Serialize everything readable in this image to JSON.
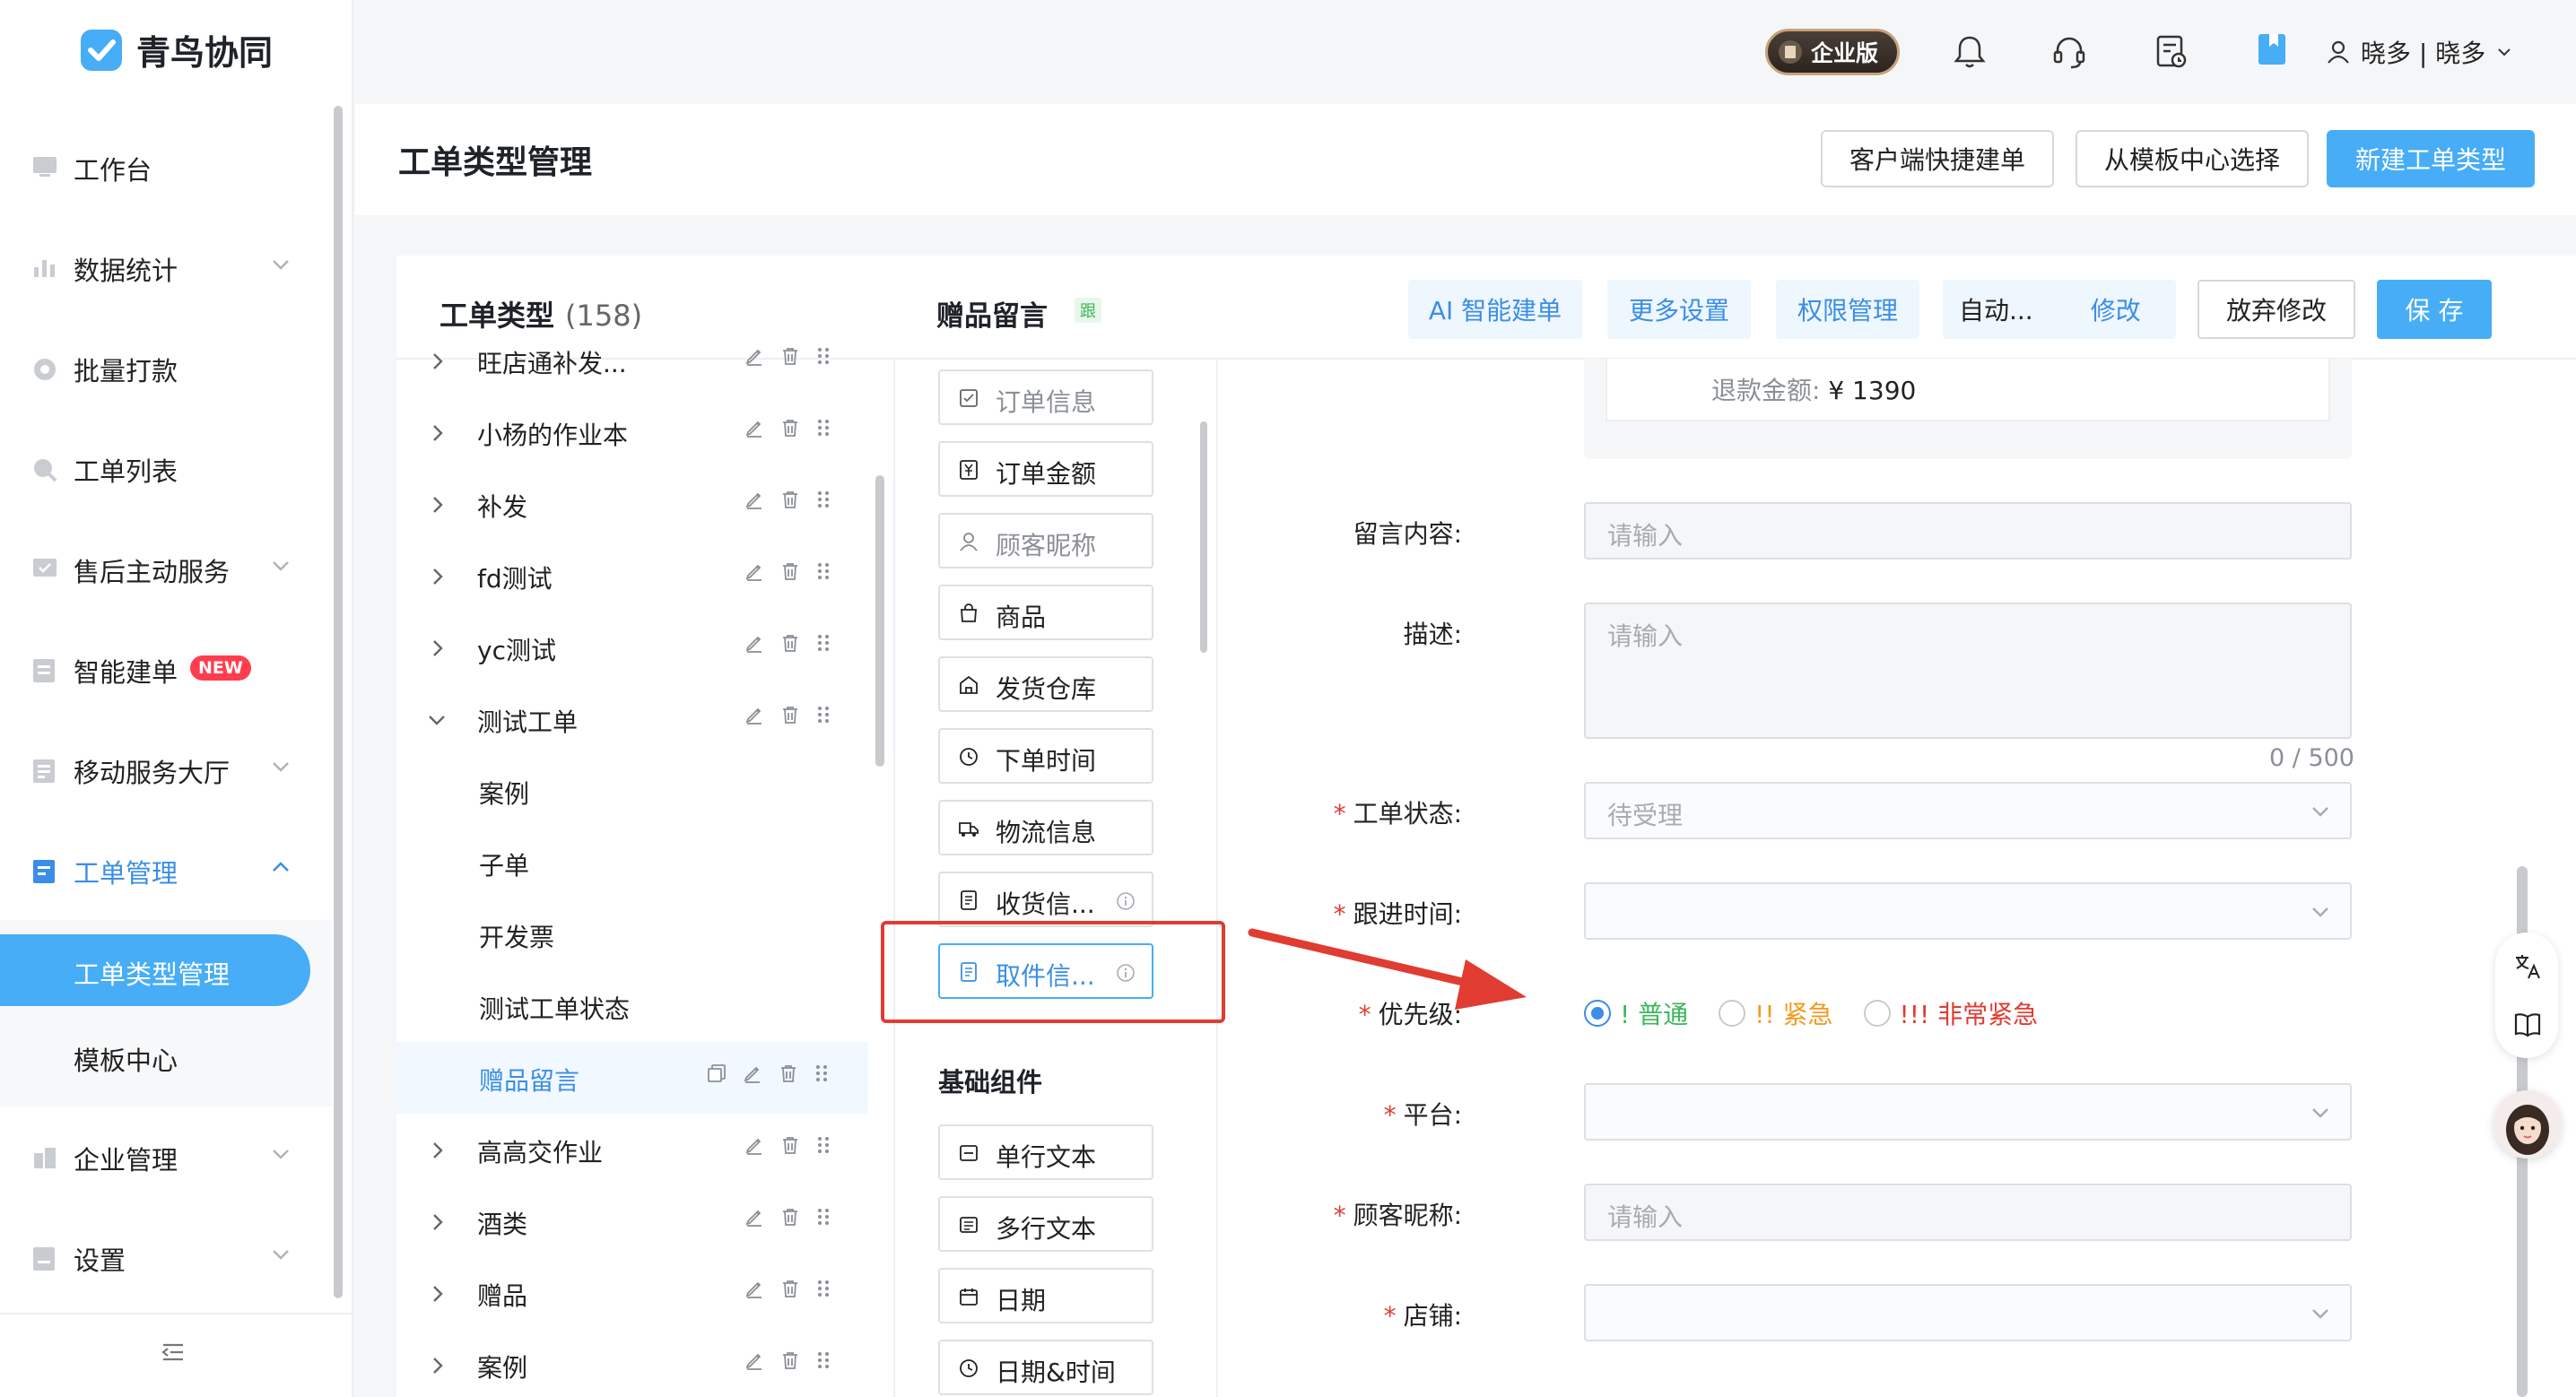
{
  "app": {
    "name": "青鸟协同"
  },
  "header": {
    "edition": "企业版",
    "user": "晓多 | 晓多"
  },
  "sidebar": {
    "items": [
      {
        "label": "工作台"
      },
      {
        "label": "数据统计"
      },
      {
        "label": "批量打款"
      },
      {
        "label": "工单列表"
      },
      {
        "label": "售后主动服务"
      },
      {
        "label": "智能建单",
        "badge": "NEW"
      },
      {
        "label": "移动服务大厅"
      },
      {
        "label": "工单管理"
      },
      {
        "label": "企业管理"
      },
      {
        "label": "设置"
      }
    ],
    "subitems": [
      {
        "label": "工单类型管理"
      },
      {
        "label": "模板中心"
      }
    ]
  },
  "page": {
    "title": "工单类型管理",
    "buttons": {
      "quick": "客户端快捷建单",
      "template": "从模板中心选择",
      "new": "新建工单类型"
    }
  },
  "types_panel": {
    "title": "工单类型",
    "count": "(158)",
    "rows": [
      {
        "label": "旺店通补发..."
      },
      {
        "label": "小杨的作业本"
      },
      {
        "label": "补发"
      },
      {
        "label": "fd测试"
      },
      {
        "label": "yc测试"
      },
      {
        "label": "测试工单"
      },
      {
        "label": "案例"
      },
      {
        "label": "子单"
      },
      {
        "label": "开发票"
      },
      {
        "label": "测试工单状态"
      },
      {
        "label": "赠品留言"
      },
      {
        "label": "高高交作业"
      },
      {
        "label": "酒类"
      },
      {
        "label": "赠品"
      },
      {
        "label": "案例"
      }
    ]
  },
  "editor": {
    "title": "赠品留言",
    "tag": "跟",
    "toolbar": {
      "ai": "AI 智能建单",
      "more": "更多设置",
      "perm": "权限管理",
      "auto": "自动...",
      "edit": "修改",
      "discard": "放弃修改",
      "save": "保 存"
    }
  },
  "palette": {
    "items": [
      {
        "label": "订单信息"
      },
      {
        "label": "订单金额"
      },
      {
        "label": "顾客昵称"
      },
      {
        "label": "商品"
      },
      {
        "label": "发货仓库"
      },
      {
        "label": "下单时间"
      },
      {
        "label": "物流信息"
      },
      {
        "label": "收货信..."
      },
      {
        "label": "取件信..."
      }
    ],
    "section": "基础组件",
    "basic": [
      {
        "label": "单行文本"
      },
      {
        "label": "多行文本"
      },
      {
        "label": "日期"
      },
      {
        "label": "日期&时间"
      }
    ]
  },
  "form": {
    "refund_label": "退款金额:",
    "refund_value": "¥ 1390",
    "fields": {
      "message": {
        "label": "留言内容:",
        "placeholder": "请输入"
      },
      "desc": {
        "label": "描述:",
        "placeholder": "请输入",
        "counter": "0 / 500"
      },
      "status": {
        "label": "工单状态:",
        "value": "待受理"
      },
      "followup": {
        "label": "跟进时间:"
      },
      "priority": {
        "label": "优先级:",
        "options": [
          "! 普通",
          "!! 紧急",
          "!!! 非常紧急"
        ],
        "selected": "! 普通"
      },
      "platform": {
        "label": "平台:"
      },
      "nickname": {
        "label": "顾客昵称:",
        "placeholder": "请输入"
      },
      "shop": {
        "label": "店铺:"
      }
    }
  },
  "colors": {
    "primary": "#47adf6",
    "accent": "#3a8ee6",
    "danger": "#e03c31",
    "normal": "#3cb65a",
    "urgent": "#f39a22",
    "very_urgent": "#e03c31"
  }
}
